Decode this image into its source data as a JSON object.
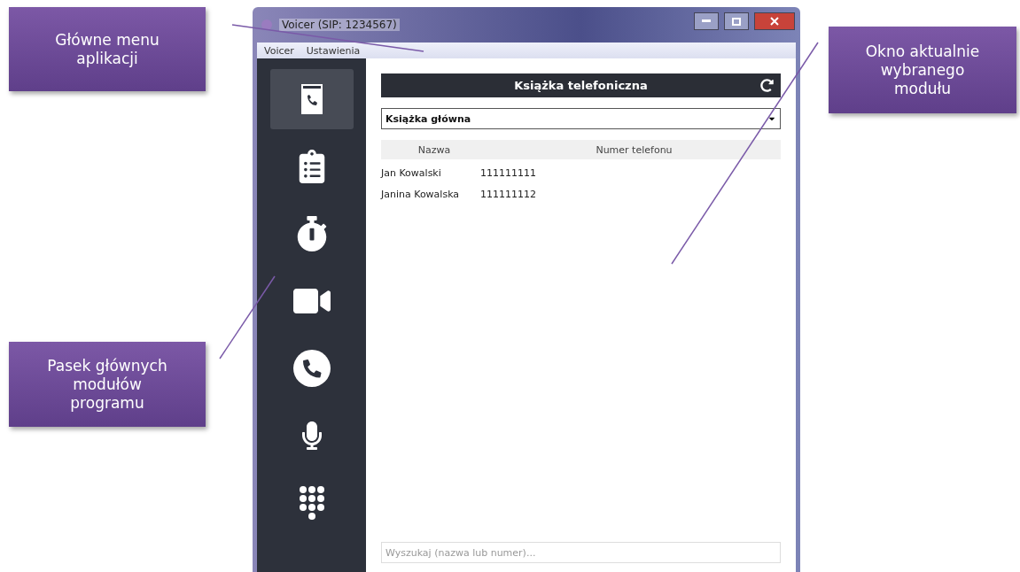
{
  "callouts": [
    "Główne menu aplikacji",
    "Okno aktualnie wybranego modułu",
    "Pasek głównych modułów programu"
  ],
  "window": {
    "title": "Voicer (SIP: 1234567)"
  },
  "menu": [
    "Voicer",
    "Ustawienia"
  ],
  "sidebar": {
    "items": [
      {
        "kind": "phonebook",
        "selected": true
      },
      {
        "kind": "history",
        "selected": false
      },
      {
        "kind": "timer",
        "selected": false
      },
      {
        "kind": "video",
        "selected": false
      },
      {
        "kind": "call",
        "selected": false
      },
      {
        "kind": "microphone",
        "selected": false
      },
      {
        "kind": "dialpad",
        "selected": false
      }
    ]
  },
  "module": {
    "title": "Książka telefoniczna",
    "book": "Książka główna",
    "table": {
      "columns": [
        "Nazwa",
        "Numer telefonu"
      ],
      "rows": [
        [
          "Jan Kowalski",
          "111111111"
        ],
        [
          "Janina Kowalska",
          "111111112"
        ]
      ]
    },
    "search": {
      "placeholder": "Wyszukaj (nazwa lub numer)..."
    }
  }
}
